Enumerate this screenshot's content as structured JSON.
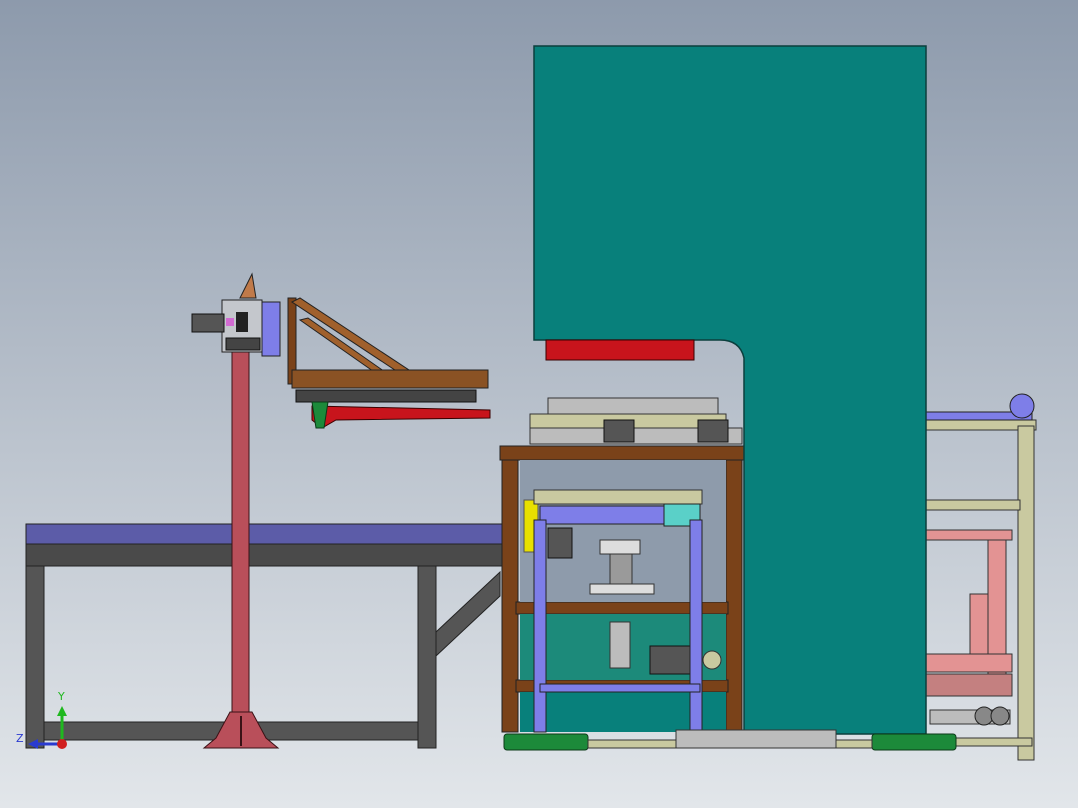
{
  "viewport": {
    "background_top": "#8d9aac",
    "background_bottom": "#e2e6ea"
  },
  "triad": {
    "x_label": "",
    "y_label": "Y",
    "z_label": "Z",
    "x_color": "#d11f1f",
    "y_color": "#1fb81f",
    "z_color": "#2a3ad0"
  },
  "colors": {
    "press_body": "#08807b",
    "press_outline": "#0b3f3d",
    "press_red_plate": "#c8141c",
    "table_top": "#5c5ca8",
    "table_frame": "#555555",
    "stand_post": "#b94f5a",
    "wood_frame": "#7a4219",
    "blue_column": "#7e7ee8",
    "feet_green": "#1c8a3a",
    "olive_frame": "#c9c9a0",
    "pink_part": "#e39393",
    "yellow_part": "#e8e000"
  },
  "components": {
    "press": "c-frame-press",
    "table": "conveyor-table",
    "stand": "feeder-stand",
    "arm": "truss-arm",
    "frame": "roller-frame",
    "right_unit": "ejector-unit"
  }
}
